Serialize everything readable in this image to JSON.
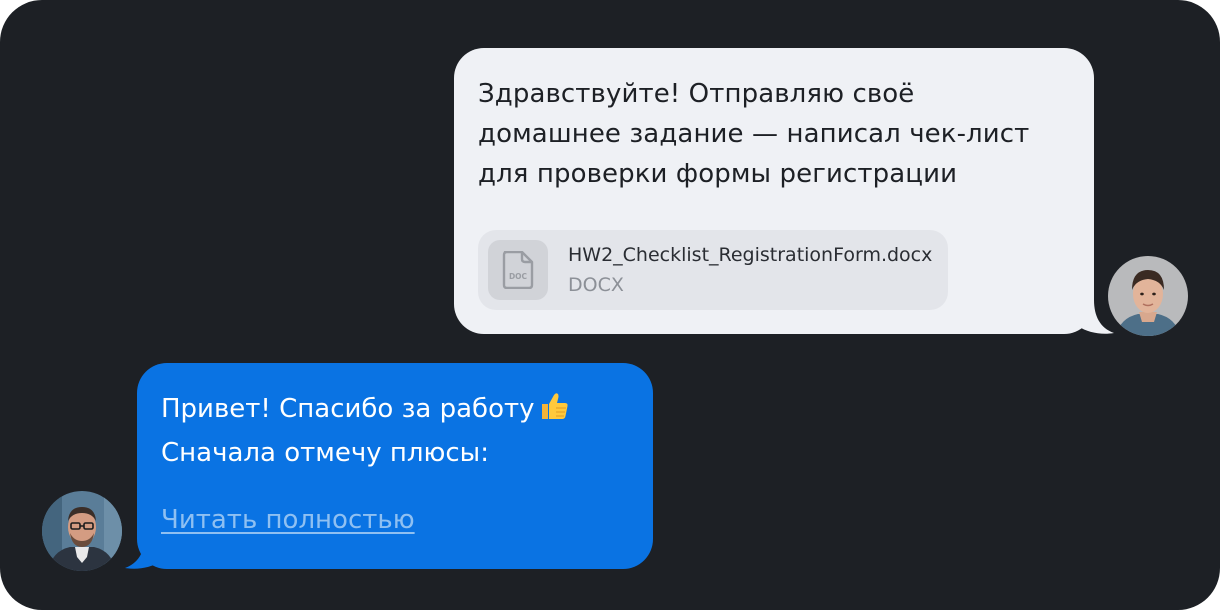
{
  "chat": {
    "messages": [
      {
        "sender": "student",
        "text": "Здравствуйте! Отправляю своё\nдомашнее задание — написал чек-лист\nдля проверки формы регистрации",
        "attachment": {
          "icon": "doc-file-icon",
          "icon_label": "DOC",
          "file_name": "HW2_Checklist_RegistrationForm.docx",
          "file_type": "DOCX"
        },
        "avatar": "student-avatar"
      },
      {
        "sender": "mentor",
        "line1": "Привет! Спасибо за работу",
        "line1_emoji": "thumbs-up-emoji",
        "line2": "Сначала отмечу плюсы:",
        "read_more_label": "Читать полностью",
        "avatar": "mentor-avatar"
      }
    ]
  },
  "colors": {
    "background": "#1d2025",
    "outgoing_bubble": "#eff1f5",
    "incoming_bubble": "#0a73e3",
    "link": "#8fc0f2"
  }
}
